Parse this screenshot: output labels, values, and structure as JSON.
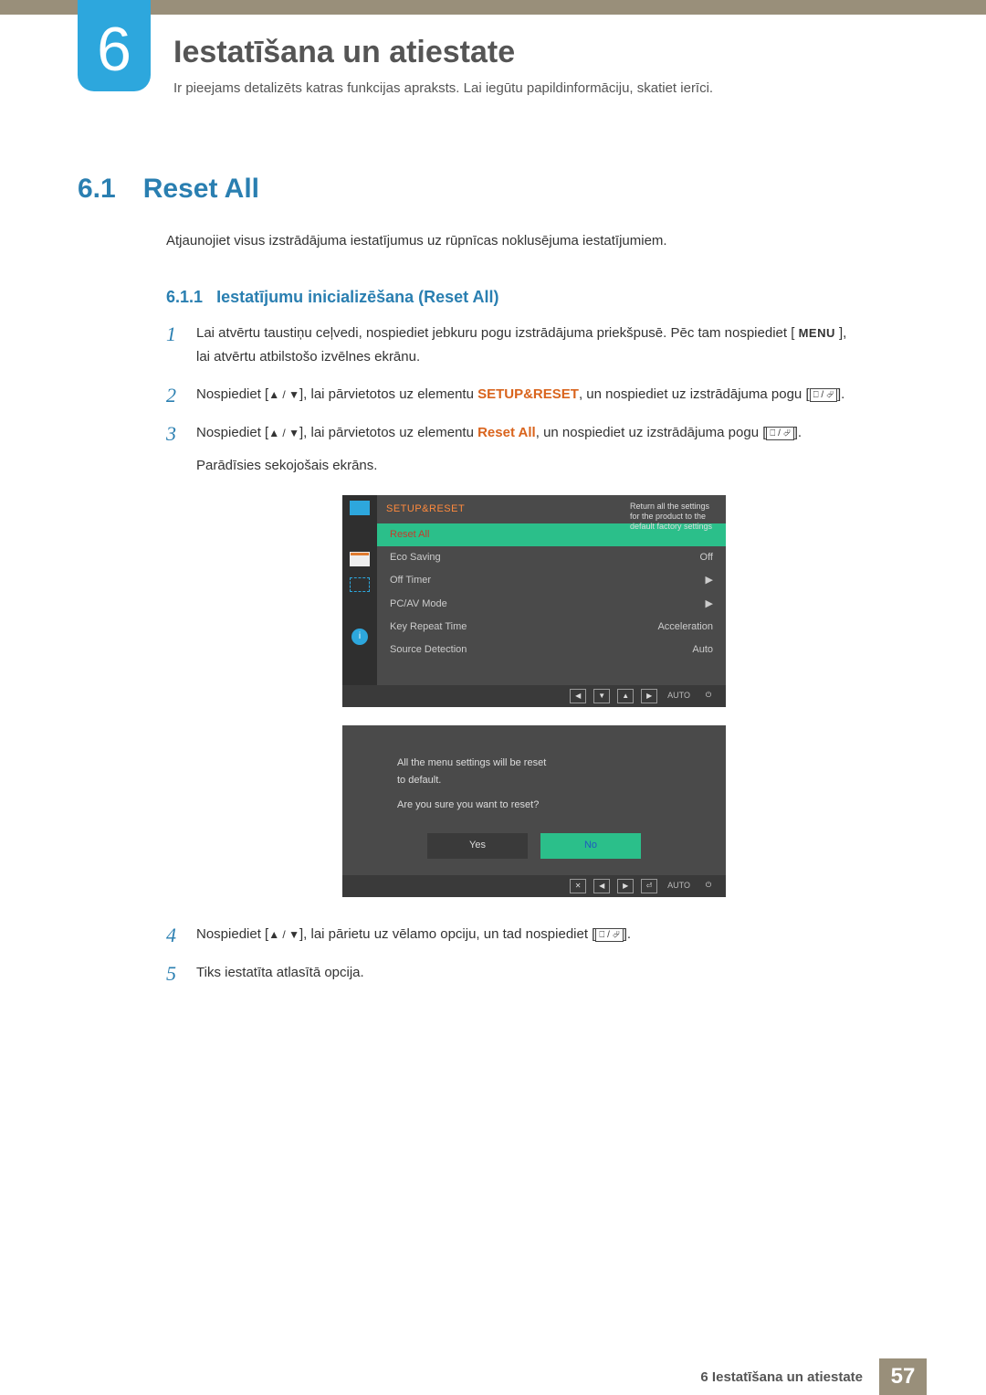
{
  "chapter": {
    "number": "6",
    "title": "Iestatīšana un atiestate",
    "description": "Ir pieejams detalizēts katras funkcijas apraksts. Lai iegūtu papildinformāciju, skatiet ierīci."
  },
  "section": {
    "number": "6.1",
    "title": "Reset All",
    "description": "Atjaunojiet visus izstrādājuma iestatījumus uz rūpnīcas noklusējuma iestatījumiem."
  },
  "subsection": {
    "number": "6.1.1",
    "title": "Iestatījumu inicializēšana (Reset All)"
  },
  "steps": {
    "s1_a": "Lai atvērtu taustiņu ceļvedi, nospiediet jebkuru pogu izstrādājuma priekšpusē. Pēc tam nospiediet [",
    "s1_menu": "MENU",
    "s1_b": "], lai atvērtu atbilstošo izvēlnes ekrānu.",
    "s2_a": "Nospiediet [",
    "s2_b": "], lai pārvietotos uz elementu ",
    "s2_bold": "SETUP&RESET",
    "s2_c": ", un nospiediet uz izstrādājuma pogu [",
    "s2_d": "].",
    "s3_a": "Nospiediet [",
    "s3_b": "], lai pārvietotos uz elementu ",
    "s3_bold": "Reset All",
    "s3_c": ", un nospiediet uz izstrādājuma pogu [",
    "s3_d": "].",
    "s3_caption": "Parādīsies sekojošais ekrāns.",
    "s4_a": "Nospiediet [",
    "s4_b": "], lai pārietu uz vēlamo opciju, un tad nospiediet [",
    "s4_c": "].",
    "s5": "Tiks iestatīta atlasītā opcija."
  },
  "step_numbers": {
    "n1": "1",
    "n2": "2",
    "n3": "3",
    "n4": "4",
    "n5": "5"
  },
  "osd_menu": {
    "header": "SETUP&RESET",
    "tooltip_l1": "Return all the settings",
    "tooltip_l2": "for the product to the",
    "tooltip_l3": "default factory settings",
    "items": [
      {
        "label": "Reset All",
        "value": ""
      },
      {
        "label": "Eco Saving",
        "value": "Off"
      },
      {
        "label": "Off Timer",
        "value": "▶"
      },
      {
        "label": "PC/AV Mode",
        "value": "▶"
      },
      {
        "label": "Key Repeat Time",
        "value": "Acceleration"
      },
      {
        "label": "Source Detection",
        "value": "Auto"
      }
    ],
    "nav_auto": "AUTO"
  },
  "osd_dialog": {
    "line1": "All the menu settings will be reset",
    "line2": "to default.",
    "line3": "Are you sure you want to reset?",
    "yes": "Yes",
    "no": "No",
    "nav_auto": "AUTO"
  },
  "icons": {
    "updown": "▲ / ▼",
    "okenter": "⎕ / ⏎"
  },
  "footer": {
    "text": "6 Iestatīšana un atiestate",
    "page": "57"
  }
}
